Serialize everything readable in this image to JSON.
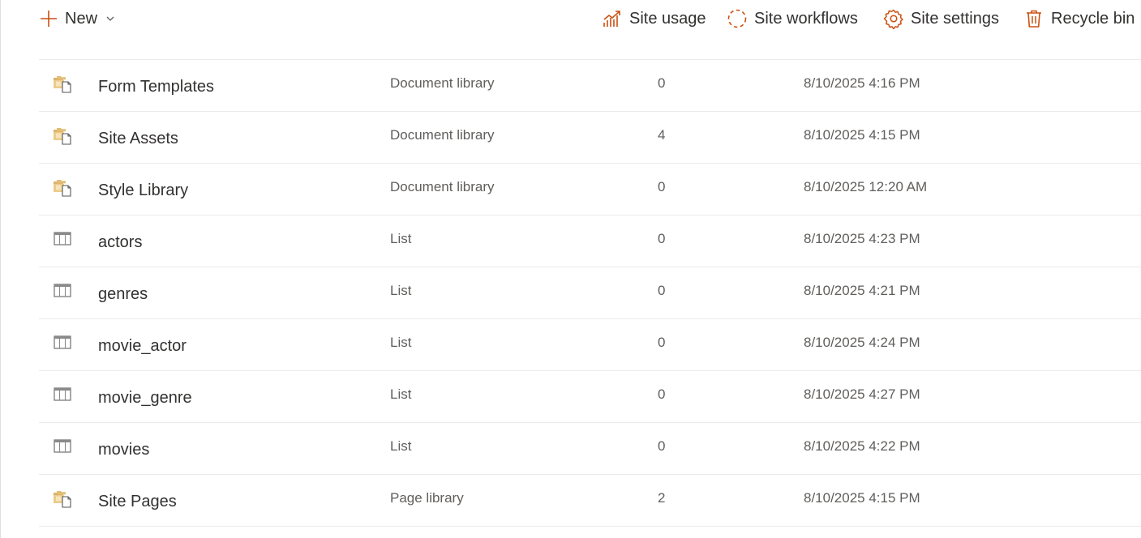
{
  "accent_color": "#ca5010",
  "commandbar": {
    "new_label": "New",
    "site_usage_label": "Site usage",
    "site_workflows_label": "Site workflows",
    "site_settings_label": "Site settings",
    "recycle_bin_label": "Recycle bin"
  },
  "contents": {
    "rows": [
      {
        "icon": "document-library-icon",
        "name": "Form Templates",
        "type": "Document library",
        "items": "0",
        "modified": "8/10/2025 4:16 PM"
      },
      {
        "icon": "document-library-icon",
        "name": "Site Assets",
        "type": "Document library",
        "items": "4",
        "modified": "8/10/2025 4:15 PM"
      },
      {
        "icon": "document-library-icon",
        "name": "Style Library",
        "type": "Document library",
        "items": "0",
        "modified": "8/10/2025 12:20 AM"
      },
      {
        "icon": "list-icon",
        "name": "actors",
        "type": "List",
        "items": "0",
        "modified": "8/10/2025 4:23 PM"
      },
      {
        "icon": "list-icon",
        "name": "genres",
        "type": "List",
        "items": "0",
        "modified": "8/10/2025 4:21 PM"
      },
      {
        "icon": "list-icon",
        "name": "movie_actor",
        "type": "List",
        "items": "0",
        "modified": "8/10/2025 4:24 PM"
      },
      {
        "icon": "list-icon",
        "name": "movie_genre",
        "type": "List",
        "items": "0",
        "modified": "8/10/2025 4:27 PM"
      },
      {
        "icon": "list-icon",
        "name": "movies",
        "type": "List",
        "items": "0",
        "modified": "8/10/2025 4:22 PM"
      },
      {
        "icon": "document-library-icon",
        "name": "Site Pages",
        "type": "Page library",
        "items": "2",
        "modified": "8/10/2025 4:15 PM"
      }
    ]
  }
}
